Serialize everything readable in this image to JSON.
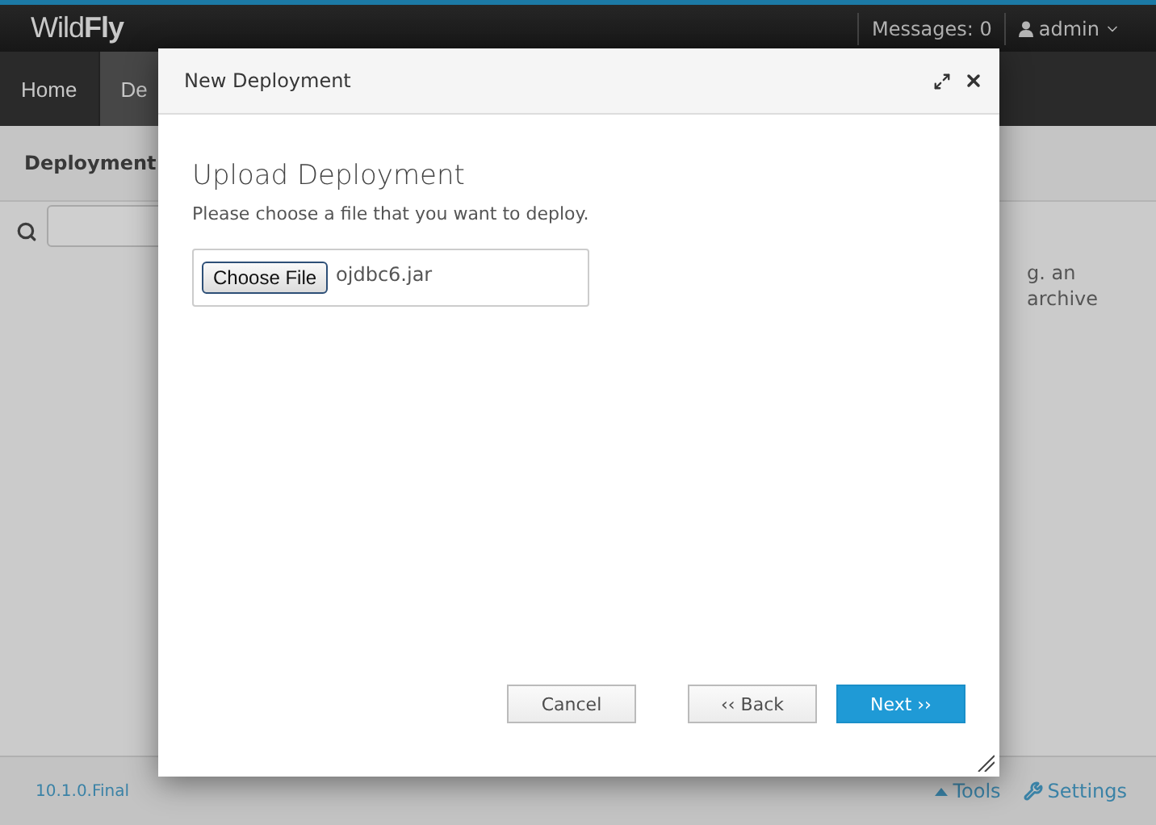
{
  "app": {
    "logo": "Wild**Fly**",
    "messages": "Messages: 0",
    "user": "admin"
  },
  "nav_tabs": [
    {
      "label": "Home",
      "selected": false
    },
    {
      "label": "De",
      "selected": true
    }
  ],
  "subheader": {
    "title": "Deployment"
  },
  "background_text": [
    "g. an",
    "archive"
  ],
  "footer": {
    "version": "10.1.0.Final",
    "links": [
      {
        "label": "Tools",
        "kind": "tools"
      },
      {
        "label": "Settings",
        "kind": "settings"
      }
    ]
  },
  "dialog": {
    "title": "New Deployment",
    "heading": "Upload Deployment",
    "description": "Please choose a file that you want to deploy.",
    "file_button": "Choose File",
    "file_name": "ojdbc6.jar",
    "buttons": [
      {
        "label": "Cancel",
        "kind": "default"
      },
      {
        "label": "‹‹ Back",
        "kind": "default"
      },
      {
        "label": "Next ››",
        "kind": "primary"
      }
    ]
  }
}
